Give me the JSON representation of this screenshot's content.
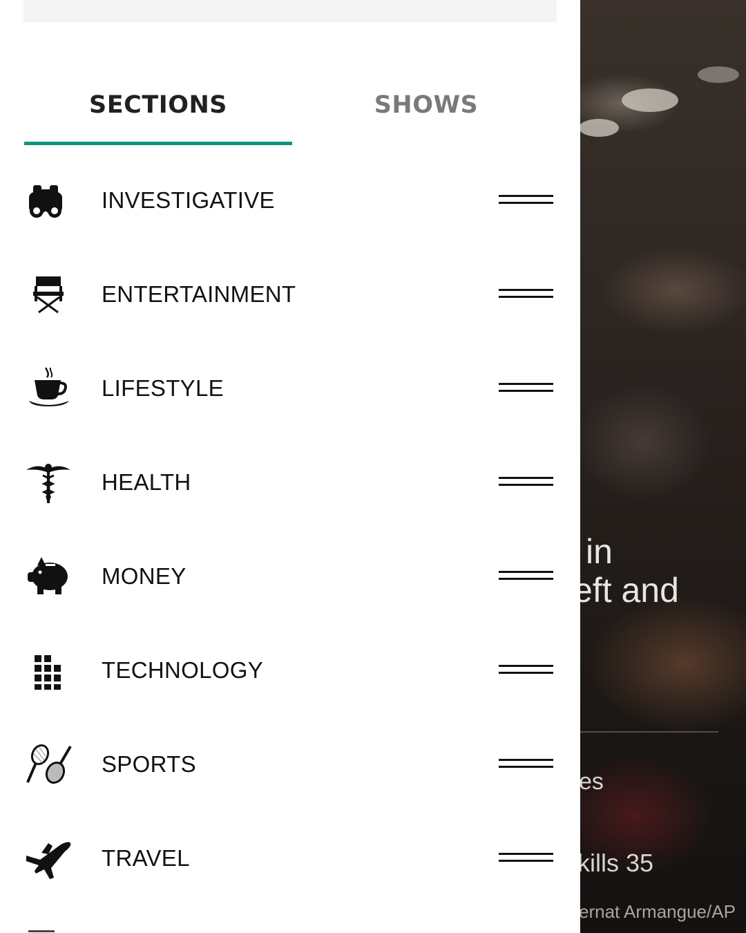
{
  "tabs": [
    {
      "label": "SECTIONS",
      "active": true
    },
    {
      "label": "SHOWS",
      "active": false
    }
  ],
  "accent_color": "#13907e",
  "sections": [
    {
      "label": "INVESTIGATIVE",
      "icon": "binoculars-icon"
    },
    {
      "label": "ENTERTAINMENT",
      "icon": "director-chair-icon"
    },
    {
      "label": "LIFESTYLE",
      "icon": "coffee-cup-icon"
    },
    {
      "label": "HEALTH",
      "icon": "caduceus-icon"
    },
    {
      "label": "MONEY",
      "icon": "piggy-bank-icon"
    },
    {
      "label": "TECHNOLOGY",
      "icon": "grid-blocks-icon"
    },
    {
      "label": "SPORTS",
      "icon": "rackets-icon"
    },
    {
      "label": "TRAVEL",
      "icon": "airplane-icon"
    }
  ],
  "background_article": {
    "headline_line1": "in",
    "headline_line2": "eft and",
    "text_fragment1": "es",
    "text_fragment2": "kills 35",
    "photo_credit": "ernat Armangue/AP"
  }
}
